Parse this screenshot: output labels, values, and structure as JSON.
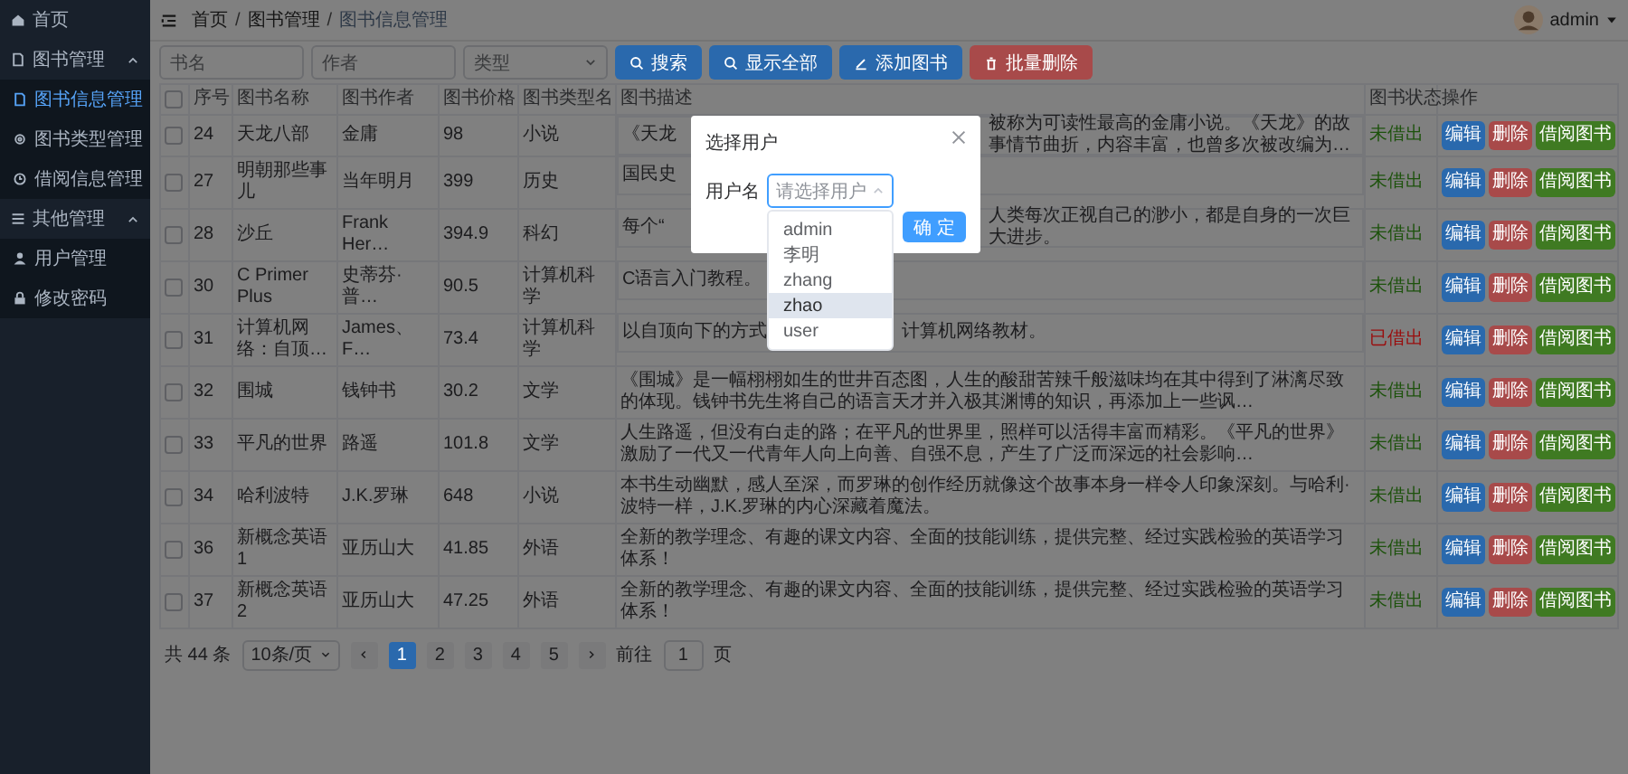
{
  "sidebar": {
    "items": [
      {
        "label": "首页",
        "selected": false
      },
      {
        "label": "图书管理",
        "selected": false,
        "expanded": true,
        "children": [
          {
            "label": "图书信息管理",
            "selected": true
          },
          {
            "label": "图书类型管理",
            "selected": false
          },
          {
            "label": "借阅信息管理",
            "selected": false
          }
        ]
      },
      {
        "label": "其他管理",
        "selected": false,
        "expanded": true,
        "children": [
          {
            "label": "用户管理",
            "selected": false
          },
          {
            "label": "修改密码",
            "selected": false
          }
        ]
      }
    ]
  },
  "header": {
    "breadcrumb": [
      {
        "label": "首页"
      },
      {
        "separator": "/",
        "label": "图书管理"
      },
      {
        "separator": "/",
        "label": "图书信息管理"
      }
    ],
    "user": "admin"
  },
  "search": {
    "fields": [
      {
        "placeholder": "书名",
        "kind": "input"
      },
      {
        "placeholder": "作者",
        "kind": "input"
      },
      {
        "placeholder": "类型",
        "kind": "select"
      }
    ],
    "buttons": [
      {
        "label": "搜索",
        "kind": "primary"
      },
      {
        "label": "显示全部",
        "kind": "primary"
      },
      {
        "label": "添加图书",
        "kind": "primary"
      },
      {
        "label": "批量删除",
        "kind": "danger"
      }
    ]
  },
  "table": {
    "all_checked": false,
    "columns": [
      "序号",
      "图书名称",
      "图书作者",
      "图书价格",
      "图书类型名",
      "图书描述",
      "图书状态",
      "操作"
    ],
    "rows": [
      {
        "checked": false,
        "cells": [
          "24",
          "天龙八部",
          "金庸",
          "98",
          "小说"
        ],
        "description": [
          "《天龙",
          "被称为可读性最高的金庸小说。《天龙》的故事情节曲折，内容丰富，也曾多次被改编为…"
        ],
        "status": "未借出",
        "borrowed": false,
        "actions": [
          {
            "label": "编辑",
            "kind": "edit"
          },
          {
            "label": "删除",
            "kind": "delete"
          },
          {
            "label": "借阅图书",
            "kind": "borrow"
          }
        ]
      },
      {
        "checked": false,
        "cells": [
          "27",
          "明朝那些事儿",
          "当年明月",
          "399",
          "历史"
        ],
        "description": [
          "国民史"
        ],
        "status": "未借出",
        "borrowed": false,
        "actions": [
          {
            "label": "编辑",
            "kind": "edit"
          },
          {
            "label": "删除",
            "kind": "delete"
          },
          {
            "label": "借阅图书",
            "kind": "borrow"
          }
        ]
      },
      {
        "checked": false,
        "cells": [
          "28",
          "沙丘",
          "Frank Her…",
          "394.9",
          "科幻"
        ],
        "description": [
          "每个“",
          "人类每次正视自己的渺小，都是自身的一次巨大进步。"
        ],
        "status": "未借出",
        "borrowed": false,
        "actions": [
          {
            "label": "编辑",
            "kind": "edit"
          },
          {
            "label": "删除",
            "kind": "delete"
          },
          {
            "label": "借阅图书",
            "kind": "borrow"
          }
        ]
      },
      {
        "checked": false,
        "cells": [
          "30",
          "C Primer Plus",
          "史蒂芬·普…",
          "90.5",
          "计算机科学"
        ],
        "description": [
          "C语言入门教程。"
        ],
        "status": "未借出",
        "borrowed": false,
        "actions": [
          {
            "label": "编辑",
            "kind": "edit"
          },
          {
            "label": "删除",
            "kind": "delete"
          },
          {
            "label": "借阅图书",
            "kind": "borrow"
          }
        ]
      },
      {
        "checked": false,
        "cells": [
          "31",
          "计算机网络：自顶…",
          "James、F…",
          "73.4",
          "计算机科学"
        ],
        "description": [
          "以自顶向下的方式",
          "计算机网络教材。"
        ],
        "status": "已借出",
        "borrowed": true,
        "actions": [
          {
            "label": "编辑",
            "kind": "edit"
          },
          {
            "label": "删除",
            "kind": "delete"
          },
          {
            "label": "借阅图书",
            "kind": "borrow"
          }
        ]
      },
      {
        "checked": false,
        "cells": [
          "32",
          "围城",
          "钱钟书",
          "30.2",
          "文学"
        ],
        "description": [
          "《围城》是一幅栩栩如生的世井百态图，人生的酸甜苦辣千般滋味均在其中得到了淋漓尽致的体现。钱钟书先生将自己的语言天才并入极其渊博的知识，再添加上一些讽…"
        ],
        "status": "未借出",
        "borrowed": false,
        "actions": [
          {
            "label": "编辑",
            "kind": "edit"
          },
          {
            "label": "删除",
            "kind": "delete"
          },
          {
            "label": "借阅图书",
            "kind": "borrow"
          }
        ]
      },
      {
        "checked": false,
        "cells": [
          "33",
          "平凡的世界",
          "路遥",
          "101.8",
          "文学"
        ],
        "description": [
          "人生路遥，但没有白走的路；在平凡的世界里，照样可以活得丰富而精彩。《平凡的世界》激励了一代又一代青年人向上向善、自强不息，产生了广泛而深远的社会影响…"
        ],
        "status": "未借出",
        "borrowed": false,
        "actions": [
          {
            "label": "编辑",
            "kind": "edit"
          },
          {
            "label": "删除",
            "kind": "delete"
          },
          {
            "label": "借阅图书",
            "kind": "borrow"
          }
        ]
      },
      {
        "checked": false,
        "cells": [
          "34",
          "哈利波特",
          "J.K.罗琳",
          "648",
          "小说"
        ],
        "description": [
          "本书生动幽默，感人至深，而罗琳的创作经历就像这个故事本身一样令人印象深刻。与哈利·波特一样，J.K.罗琳的内心深藏着魔法。"
        ],
        "status": "未借出",
        "borrowed": false,
        "actions": [
          {
            "label": "编辑",
            "kind": "edit"
          },
          {
            "label": "删除",
            "kind": "delete"
          },
          {
            "label": "借阅图书",
            "kind": "borrow"
          }
        ]
      },
      {
        "checked": false,
        "cells": [
          "36",
          "新概念英语1",
          "亚历山大",
          "41.85",
          "外语"
        ],
        "description": [
          "全新的教学理念、有趣的课文内容、全面的技能训练，提供完整、经过实践检验的英语学习体系！"
        ],
        "status": "未借出",
        "borrowed": false,
        "actions": [
          {
            "label": "编辑",
            "kind": "edit"
          },
          {
            "label": "删除",
            "kind": "delete"
          },
          {
            "label": "借阅图书",
            "kind": "borrow"
          }
        ]
      },
      {
        "checked": false,
        "cells": [
          "37",
          "新概念英语2",
          "亚历山大",
          "47.25",
          "外语"
        ],
        "description": [
          "全新的教学理念、有趣的课文内容、全面的技能训练，提供完整、经过实践检验的英语学习体系！"
        ],
        "status": "未借出",
        "borrowed": false,
        "actions": [
          {
            "label": "编辑",
            "kind": "edit"
          },
          {
            "label": "删除",
            "kind": "delete"
          },
          {
            "label": "借阅图书",
            "kind": "borrow"
          }
        ]
      }
    ]
  },
  "pagination": {
    "total": "共 44 条",
    "page_size": "10条/页",
    "pages": [
      {
        "label": "1",
        "selected": true
      },
      {
        "label": "2",
        "selected": false
      },
      {
        "label": "3",
        "selected": false
      },
      {
        "label": "4",
        "selected": false
      },
      {
        "label": "5",
        "selected": false
      }
    ],
    "goto_label": "前往",
    "goto_value": "1",
    "goto_unit": "页"
  },
  "dialog": {
    "title": "选择用户",
    "field_label": "用户名",
    "placeholder": "请选择用户",
    "options": [
      {
        "label": "admin",
        "highlighted": false
      },
      {
        "label": "李明",
        "highlighted": false
      },
      {
        "label": "zhang",
        "highlighted": false
      },
      {
        "label": "zhao",
        "highlighted": true
      },
      {
        "label": "user",
        "highlighted": false
      }
    ],
    "confirm": "确 定"
  }
}
